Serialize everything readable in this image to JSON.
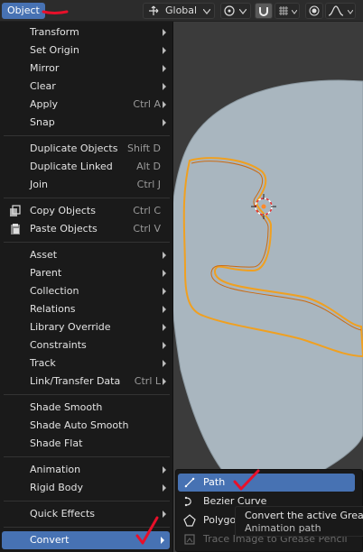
{
  "topbar": {
    "object_menu": "Object",
    "orientation": "Global",
    "proportional_icon": "falloff-curve-icon"
  },
  "menu": {
    "items": [
      {
        "label": "Transform",
        "submenu": true
      },
      {
        "label": "Set Origin",
        "submenu": true
      },
      {
        "label": "Mirror",
        "submenu": true
      },
      {
        "label": "Clear",
        "submenu": true
      },
      {
        "label": "Apply",
        "shortcut": "Ctrl A",
        "submenu": true
      },
      {
        "label": "Snap",
        "submenu": true
      },
      {
        "label": "Duplicate Objects",
        "shortcut": "Shift D"
      },
      {
        "label": "Duplicate Linked",
        "shortcut": "Alt D"
      },
      {
        "label": "Join",
        "shortcut": "Ctrl J"
      },
      {
        "label": "Copy Objects",
        "shortcut": "Ctrl C"
      },
      {
        "label": "Paste Objects",
        "shortcut": "Ctrl V"
      },
      {
        "label": "Asset",
        "submenu": true
      },
      {
        "label": "Parent",
        "submenu": true
      },
      {
        "label": "Collection",
        "submenu": true
      },
      {
        "label": "Relations",
        "submenu": true
      },
      {
        "label": "Library Override",
        "submenu": true
      },
      {
        "label": "Constraints",
        "submenu": true
      },
      {
        "label": "Track",
        "submenu": true
      },
      {
        "label": "Link/Transfer Data",
        "shortcut": "Ctrl L",
        "submenu": true
      },
      {
        "label": "Shade Smooth"
      },
      {
        "label": "Shade Auto Smooth"
      },
      {
        "label": "Shade Flat"
      },
      {
        "label": "Animation",
        "submenu": true
      },
      {
        "label": "Rigid Body",
        "submenu": true
      },
      {
        "label": "Quick Effects",
        "submenu": true
      },
      {
        "label": "Convert",
        "submenu": true
      }
    ]
  },
  "submenu": {
    "items": [
      {
        "label": "Path"
      },
      {
        "label": "Bezier Curve"
      },
      {
        "label": "Polygon"
      },
      {
        "label": "Trace Image to Grease Pencil"
      }
    ]
  },
  "tooltip": {
    "line1": "Convert the active Grease",
    "line2": "Animation path"
  },
  "colors": {
    "highlight": "#4772b3",
    "menu_bg": "#1a1a1a",
    "selection_outline": "#f5a623",
    "annotation": "#e8102a"
  }
}
